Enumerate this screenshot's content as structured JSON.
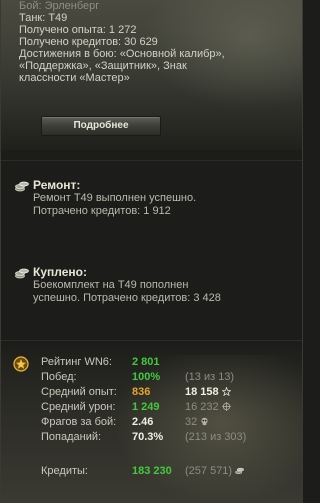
{
  "battle_info": {
    "lines": [
      "Бой: Эрленберг",
      "Танк: T49",
      "Получено опыта: 1 272",
      "Получено кредитов: 30 629",
      "Достижения в бою: «Основной калибр»,",
      "«Поддержка», «Защитник», Знак",
      "классности «Мастер»"
    ],
    "details_button": "Подробнее"
  },
  "repair": {
    "title": "Ремонт:",
    "line1": "Ремонт T49 выполнен успешно.",
    "line2": "Потрачено кредитов:  1 912"
  },
  "purchase": {
    "title": "Куплено:",
    "line1": "Боекомплект на T49 пополнен",
    "line2": "успешно. Потрачено кредитов:  3 428"
  },
  "stats": {
    "wn6_label": "Рейтинг WN6:",
    "wn6_value": "2 801",
    "wins_label": "Побед:",
    "wins_value": "100%",
    "wins_extra": "(13 из 13)",
    "avg_xp_label": "Средний опыт:",
    "avg_xp_value": "836",
    "avg_xp_extra": "18 158",
    "avg_dmg_label": "Средний урон:",
    "avg_dmg_value": "1 249",
    "avg_dmg_extra": "16 232",
    "frags_label": "Фрагов за бой:",
    "frags_value": "2.46",
    "frags_extra": "32",
    "hits_label": "Попаданий:",
    "hits_value": "70.3%",
    "hits_extra": "(213 из 303)",
    "credits_label": "Кредиты:",
    "credits_value": "183 230",
    "credits_extra": "(257 571)"
  },
  "colors": {
    "accent_green": "#43c93e",
    "accent_orange": "#e5a52a"
  }
}
